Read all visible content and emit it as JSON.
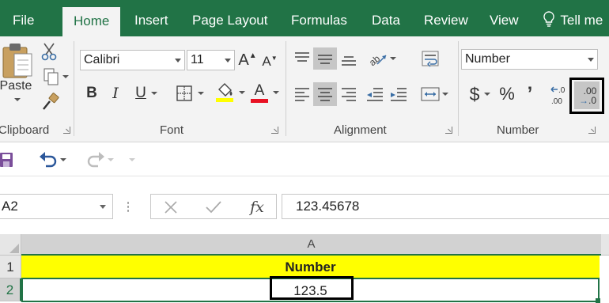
{
  "tabs": {
    "file": "File",
    "home": "Home",
    "insert": "Insert",
    "page_layout": "Page Layout",
    "formulas": "Formulas",
    "data": "Data",
    "review": "Review",
    "view": "View",
    "tell_me": "Tell me"
  },
  "clipboard": {
    "paste_label": "Paste",
    "group_label": "Clipboard"
  },
  "font": {
    "family": "Calibri",
    "size": "11",
    "group_label": "Font",
    "bold": "B",
    "italic": "I",
    "underline": "U",
    "grow": "A",
    "shrink": "A",
    "font_color_glyph": "A"
  },
  "alignment": {
    "group_label": "Alignment"
  },
  "number": {
    "format": "Number",
    "group_label": "Number",
    "currency": "$",
    "percent": "%",
    "comma": "’",
    "increase_decimal": ".00",
    "decrease_decimal_top": ".00",
    "decrease_decimal_bottom": ".0"
  },
  "formula_bar": {
    "name_box": "A2",
    "fx": "fx",
    "value": "123.45678"
  },
  "sheet": {
    "column_header": "A",
    "rows": [
      {
        "num": "1",
        "value": "Number"
      },
      {
        "num": "2",
        "value": "123.5"
      }
    ]
  },
  "colors": {
    "excel_green": "#217346",
    "header_fill": "#ffff00",
    "font_color_bar": "#e81123",
    "highlight_bar": "#ffff00"
  }
}
